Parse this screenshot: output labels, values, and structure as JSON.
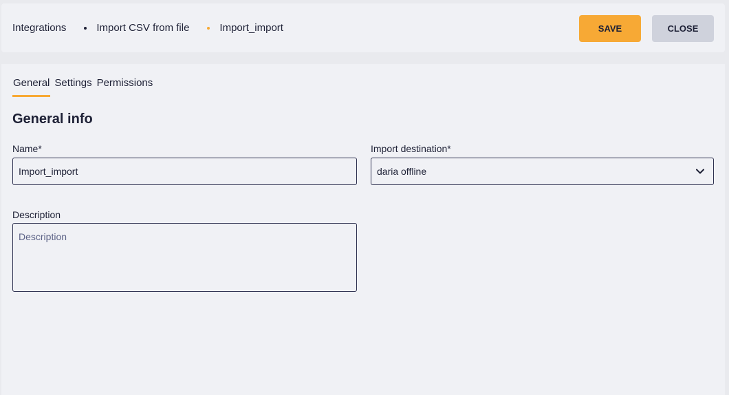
{
  "breadcrumb": {
    "items": [
      "Integrations",
      "Import CSV from file",
      "Import_import"
    ]
  },
  "actions": {
    "save_label": "SAVE",
    "close_label": "CLOSE"
  },
  "tabs": [
    {
      "label": "General",
      "active": true
    },
    {
      "label": "Settings",
      "active": false
    },
    {
      "label": "Permissions",
      "active": false
    }
  ],
  "section": {
    "title": "General info"
  },
  "form": {
    "name": {
      "label": "Name*",
      "value": "Import_import"
    },
    "destination": {
      "label": "Import destination*",
      "value": "daria offline"
    },
    "description": {
      "label": "Description",
      "placeholder": "Description",
      "value": ""
    }
  },
  "colors": {
    "accent": "#f7a935",
    "text": "#1e2136",
    "secondary_button": "#cfd2dc"
  },
  "icons": {
    "dropdown": "chevron-down-icon"
  }
}
